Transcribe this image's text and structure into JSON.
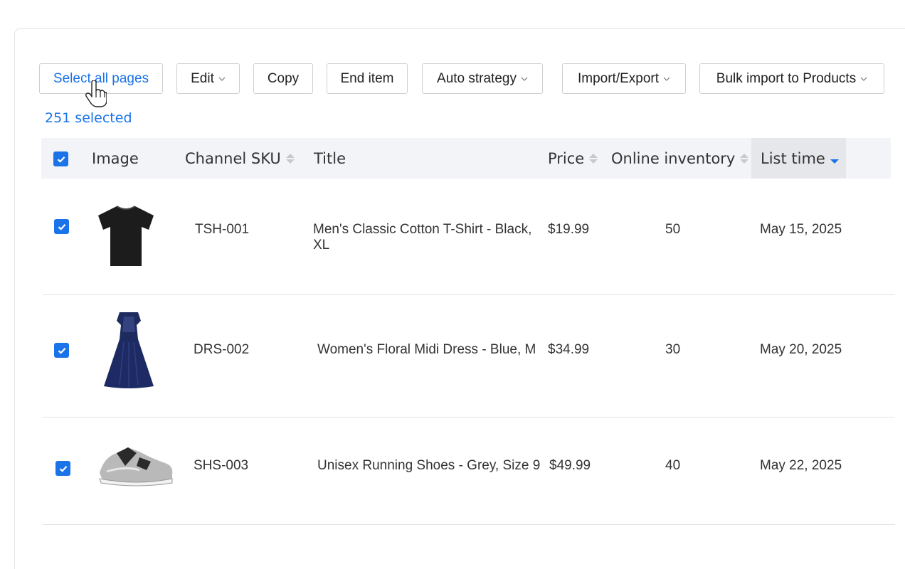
{
  "toolbar": {
    "select_all": "Select all pages",
    "edit": "Edit",
    "copy": "Copy",
    "end_item": "End item",
    "auto_strategy": "Auto strategy",
    "import_export": "Import/Export",
    "bulk_import": "Bulk import to Products"
  },
  "selection": {
    "count_text": "251 selected"
  },
  "table": {
    "headers": {
      "image": "Image",
      "channel_sku": "Channel SKU",
      "title": "Title",
      "price": "Price",
      "online_inventory": "Online inventory",
      "list_time": "List time"
    },
    "sorted_column": "List time",
    "sort_direction": "descending",
    "rows": [
      {
        "sku": "TSH-001",
        "title": "Men's Classic Cotton T-Shirt - Black, XL",
        "price": "$19.99",
        "inventory": "50",
        "list_time": "May 15, 2025",
        "image": "black-tshirt",
        "checked": true
      },
      {
        "sku": "DRS-002",
        "title": "Women's Floral Midi Dress - Blue, M",
        "price": "$34.99",
        "inventory": "30",
        "list_time": "May 20, 2025",
        "image": "blue-midi-dress",
        "checked": true
      },
      {
        "sku": "SHS-003",
        "title": "Unisex Running Shoes - Grey, Size 9",
        "price": "$49.99",
        "inventory": "40",
        "list_time": "May 22, 2025",
        "image": "grey-running-shoes",
        "checked": true
      }
    ]
  },
  "colors": {
    "accent": "#1a73e8",
    "header_bg": "#f3f4f8",
    "active_sort_bg": "#e6e7ea"
  },
  "icons": [
    "chevron-down-icon",
    "sort-arrows-icon",
    "checkbox-checked-icon",
    "hand-pointer-cursor-icon"
  ]
}
